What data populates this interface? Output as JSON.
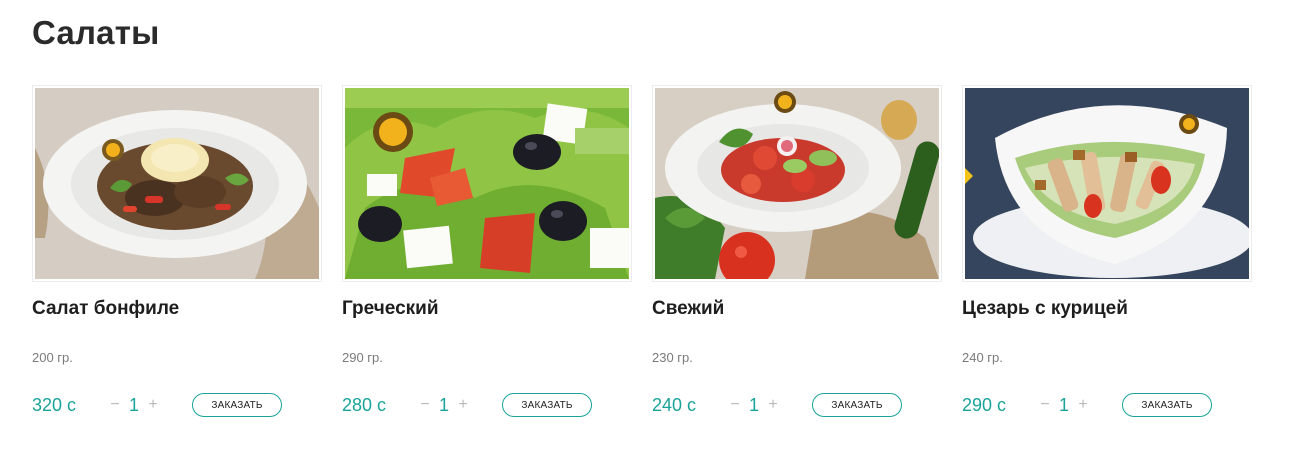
{
  "section": {
    "title": "Салаты"
  },
  "products": [
    {
      "name": "Салат бонфиле",
      "weight": "200 гр.",
      "price": "320 с",
      "qty": "1",
      "minus": "−",
      "plus": "+",
      "order_label": "ЗАКАЗАТЬ"
    },
    {
      "name": "Греческий",
      "weight": "290 гр.",
      "price": "280 с",
      "qty": "1",
      "minus": "−",
      "plus": "+",
      "order_label": "ЗАКАЗАТЬ"
    },
    {
      "name": "Свежий",
      "weight": "230 гр.",
      "price": "240 с",
      "qty": "1",
      "minus": "−",
      "plus": "+",
      "order_label": "ЗАКАЗАТЬ"
    },
    {
      "name": "Цезарь с курицей",
      "weight": "240 гр.",
      "price": "290 с",
      "qty": "1",
      "minus": "−",
      "plus": "+",
      "order_label": "ЗАКАЗАТЬ"
    }
  ],
  "colors": {
    "accent": "#1aa39a",
    "title": "#2b2b2b",
    "muted": "#7a7a7a"
  }
}
